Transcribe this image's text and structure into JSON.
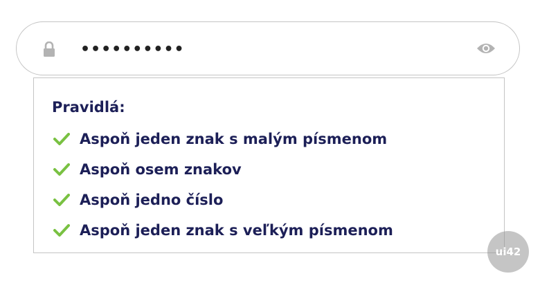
{
  "password_field": {
    "masked_value": "••••••••••",
    "lock_icon": "lock-icon",
    "toggle_icon": "eye-icon"
  },
  "rules": {
    "title": "Pravidlá:",
    "check_icon": "check-icon",
    "check_color": "#79c142",
    "text_color": "#1c1f57",
    "items": [
      {
        "label": "Aspoň jeden znak s malým písmenom"
      },
      {
        "label": "Aspoň osem znakov"
      },
      {
        "label": "Aspoň jedno číslo"
      },
      {
        "label": "Aspoň jeden znak s veľkým písmenom"
      }
    ]
  },
  "watermark": {
    "text": "ui42"
  }
}
